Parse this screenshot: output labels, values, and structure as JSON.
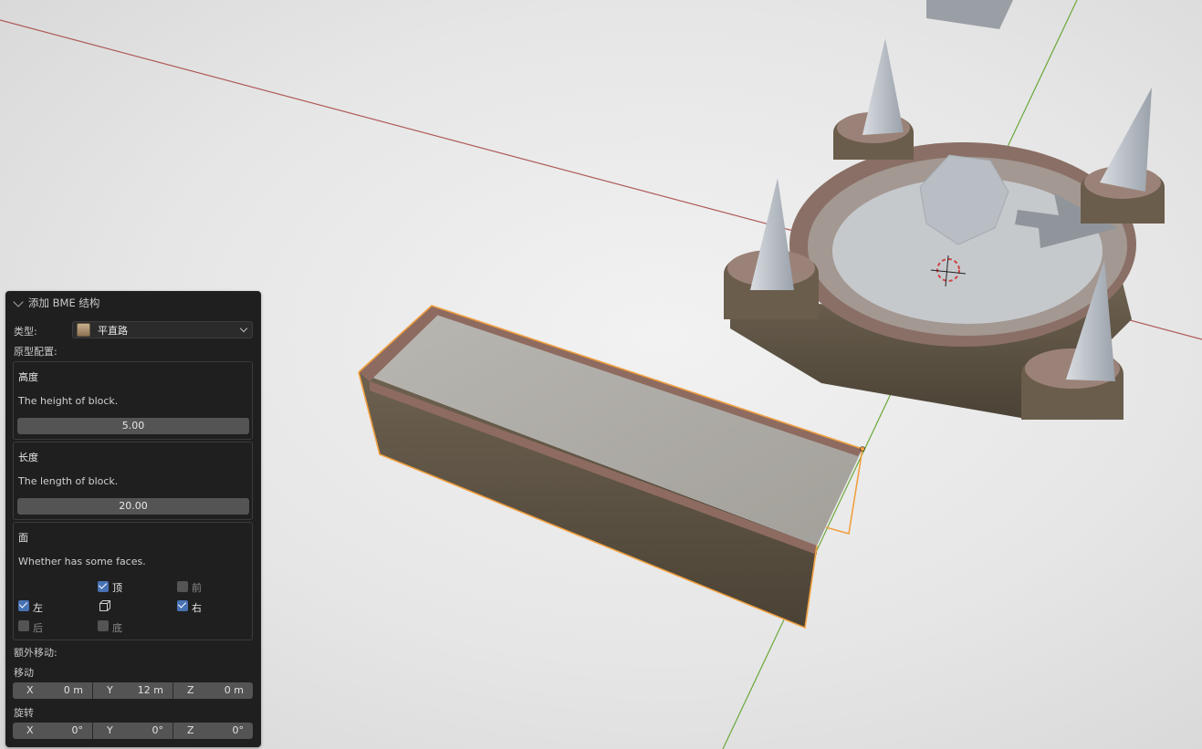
{
  "panel": {
    "title": "添加 BME 结构",
    "type_label": "类型:",
    "type_value": "平直路",
    "proto_label": "原型配置:",
    "height": {
      "title": "高度",
      "desc": "The height of block.",
      "value": "5.00"
    },
    "length": {
      "title": "长度",
      "desc": "The length of block.",
      "value": "20.00"
    },
    "faces": {
      "title": "面",
      "desc": "Whether has some faces.",
      "top": {
        "label": "顶",
        "checked": true
      },
      "front": {
        "label": "前",
        "checked": false
      },
      "left": {
        "label": "左",
        "checked": true
      },
      "right": {
        "label": "右",
        "checked": true
      },
      "back": {
        "label": "后",
        "checked": false
      },
      "bottom": {
        "label": "底",
        "checked": false
      }
    },
    "extra_label": "额外移动:",
    "move": {
      "label": "移动",
      "x_axis": "X",
      "x": "0 m",
      "y_axis": "Y",
      "y": "12 m",
      "z_axis": "Z",
      "z": "0 m"
    },
    "rotate": {
      "label": "旋转",
      "x_axis": "X",
      "x": "0°",
      "y_axis": "Y",
      "y": "0°",
      "z_axis": "Z",
      "z": "0°"
    }
  },
  "colors": {
    "accent": "#4772b3",
    "selection_outline": "#f0a040",
    "x_axis": "#b05a5a",
    "y_axis": "#6aa83a"
  }
}
